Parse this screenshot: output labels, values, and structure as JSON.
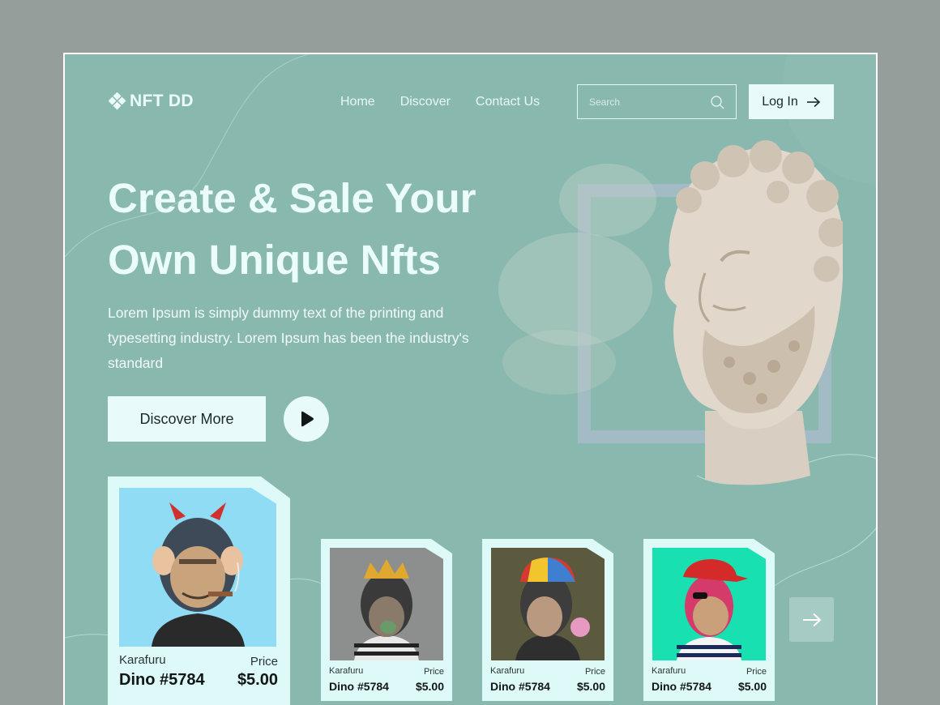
{
  "brand": {
    "name": "NFT DD"
  },
  "nav": {
    "items": [
      "Home",
      "Discover",
      "Contact Us"
    ]
  },
  "search": {
    "placeholder": "Search"
  },
  "login": {
    "label": "Log In"
  },
  "hero": {
    "title_line1": "Create & Sale Your",
    "title_line2": "Own Unique Nfts",
    "text": "Lorem Ipsum is simply dummy text of the printing and typesetting industry. Lorem Ipsum has been the industry's standard",
    "discover_label": "Discover More"
  },
  "cards": [
    {
      "creator": "Karafuru",
      "price_label": "Price",
      "name": "Dino #5784",
      "price": "$5.00"
    },
    {
      "creator": "Karafuru",
      "price_label": "Price",
      "name": "Dino #5784",
      "price": "$5.00"
    },
    {
      "creator": "Karafuru",
      "price_label": "Price",
      "name": "Dino #5784",
      "price": "$5.00"
    },
    {
      "creator": "Karafuru",
      "price_label": "Price",
      "name": "Dino #5784",
      "price": "$5.00"
    }
  ],
  "icons": {
    "logo": "diamond-cluster-icon",
    "search": "search-icon",
    "login": "arrow-right-icon",
    "play": "play-icon",
    "next": "arrow-right-icon"
  },
  "colors": {
    "page_bg": "#969e9b",
    "hero_bg": "#89b8ae",
    "light": "#e8fbfa",
    "frame_accent": "#a3bbc4"
  }
}
